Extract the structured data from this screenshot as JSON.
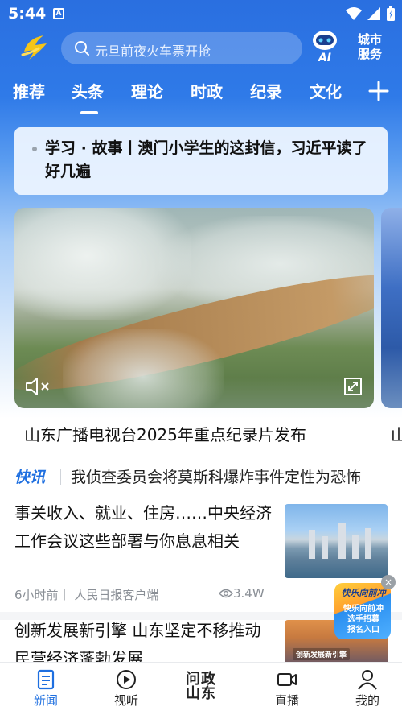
{
  "status_bar": {
    "time": "5:44",
    "notification": "A"
  },
  "header": {
    "search_placeholder": "元旦前夜火车票开抢",
    "ai_label": "AI",
    "city_service_line1": "城市",
    "city_service_line2": "服务"
  },
  "tabs": [
    {
      "label": "推荐",
      "active": false
    },
    {
      "label": "头条",
      "active": true
    },
    {
      "label": "理论",
      "active": false
    },
    {
      "label": "时政",
      "active": false
    },
    {
      "label": "纪录",
      "active": false
    },
    {
      "label": "文化",
      "active": false
    }
  ],
  "headline_card": {
    "text": "学习 · 故事丨澳门小学生的这封信，习近平读了好几遍"
  },
  "carousel": {
    "caption": "山东广播电视台2025年重点纪录片发布",
    "next_caption": "山"
  },
  "flash": {
    "badge": "快讯",
    "text": "我侦查委员会将莫斯科爆炸事件定性为恐怖"
  },
  "articles": [
    {
      "title": "事关收入、就业、住房……中央经济工作会议这些部署与你息息相关",
      "time": "6小时前丨",
      "source": "人民日报客户端",
      "views": "3.4W"
    },
    {
      "title": "创新发展新引擎 山东坚定不移推动民营经济蓬勃发展",
      "thumb_label": "创新发展新引擎"
    }
  ],
  "promo": {
    "title": "快乐向前冲",
    "text_line1": "快乐向前冲",
    "text_line2": "选手招募",
    "text_line3": "报名入口"
  },
  "bottom_nav": [
    {
      "label": "新闻",
      "icon": "news-icon",
      "active": true
    },
    {
      "label": "视听",
      "icon": "play-icon",
      "active": false
    },
    {
      "label_line1": "问政",
      "label_line2": "山东",
      "active": false
    },
    {
      "label": "直播",
      "icon": "live-camera-icon",
      "active": false
    },
    {
      "label": "我的",
      "icon": "profile-icon",
      "active": false
    }
  ],
  "colors": {
    "brand_blue": "#1e6fe0",
    "header_blue": "#2f7ae8"
  }
}
